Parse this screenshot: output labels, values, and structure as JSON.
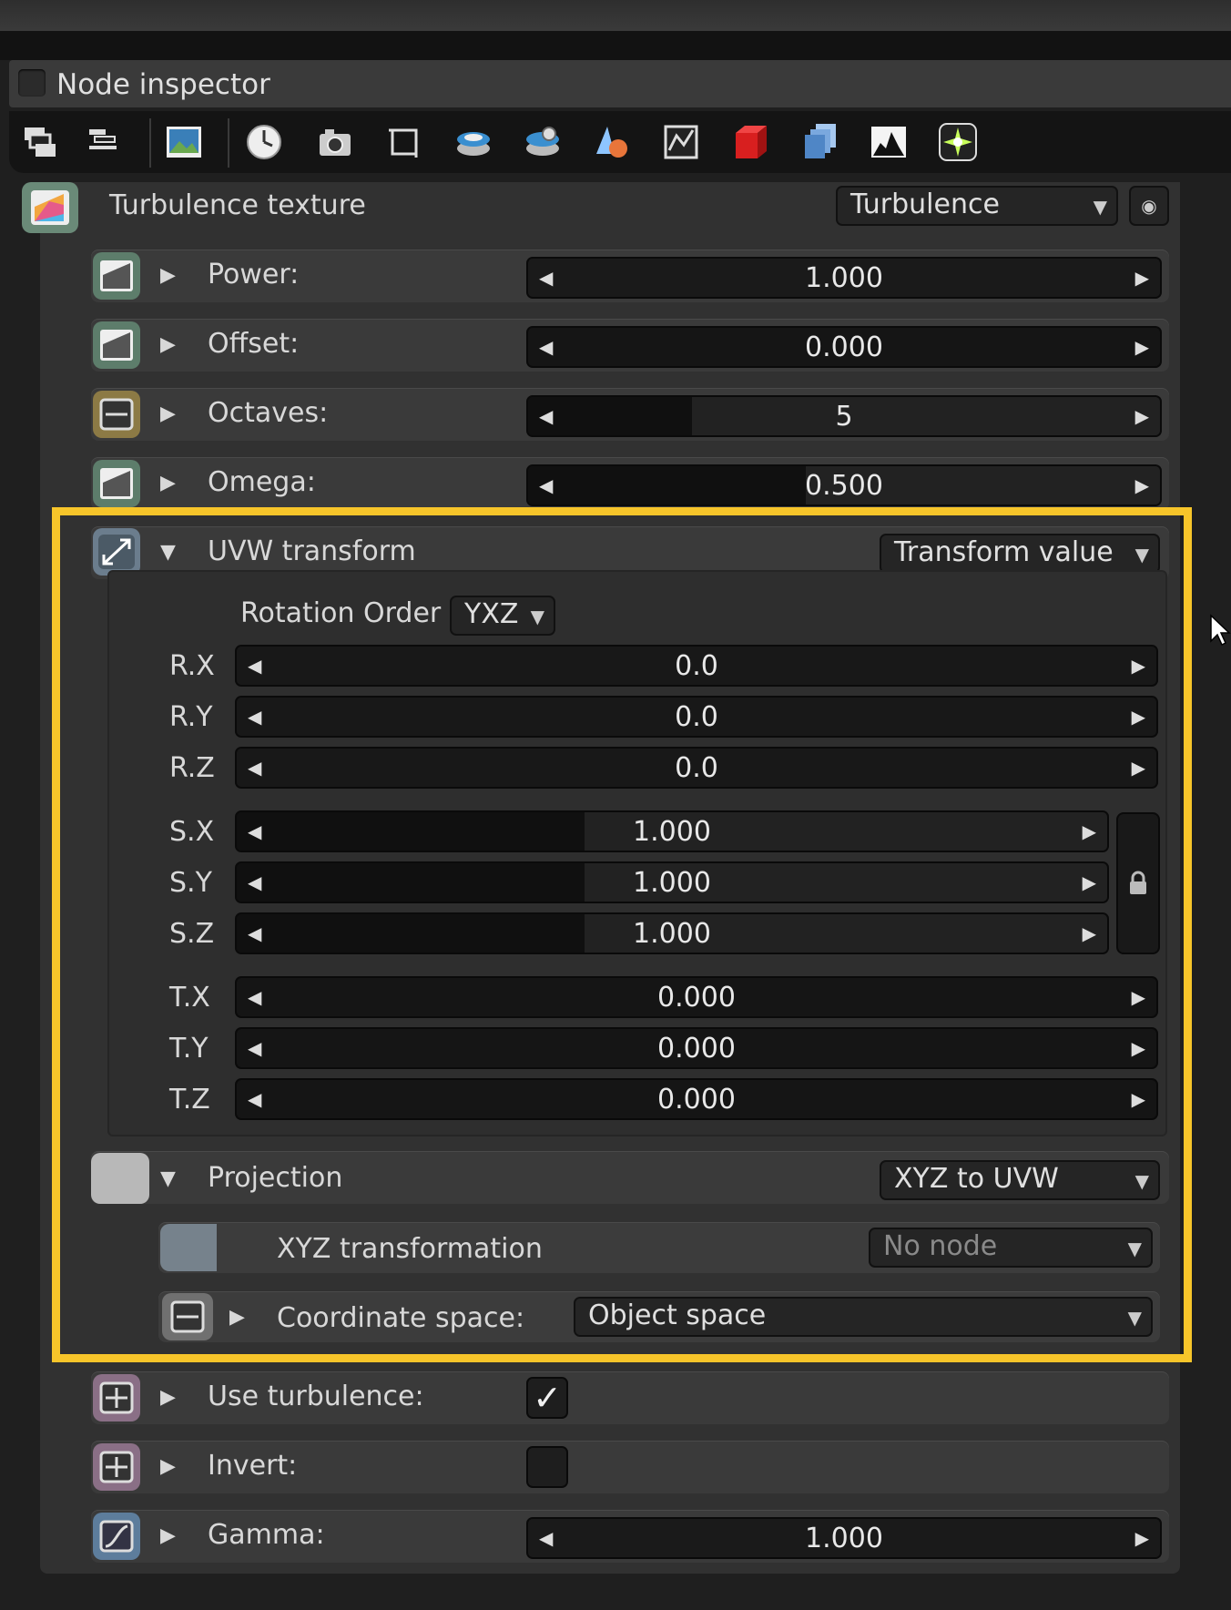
{
  "inspector": {
    "title": "Node inspector"
  },
  "toolbar": {
    "icons": [
      "layers-icon",
      "list-icon",
      "image-icon",
      "clock-icon",
      "camera-icon",
      "crop-icon",
      "disk-icon",
      "disk-settings-icon",
      "shader-icon",
      "graph-icon",
      "red-cube-icon",
      "blue-cube-icon",
      "histogram-icon",
      "sparkle-icon"
    ]
  },
  "node": {
    "name": "Turbulence texture",
    "type": "Turbulence"
  },
  "params": {
    "power": {
      "label": "Power:",
      "value": "1.000"
    },
    "offset": {
      "label": "Offset:",
      "value": "0.000"
    },
    "octaves": {
      "label": "Octaves:",
      "value": "5"
    },
    "omega": {
      "label": "Omega:",
      "value": "0.500"
    }
  },
  "uvw": {
    "label": "UVW transform",
    "mode": "Transform value",
    "rotation_order_label": "Rotation Order",
    "rotation_order": "YXZ",
    "rx": {
      "label": "R.X",
      "value": "0.0"
    },
    "ry": {
      "label": "R.Y",
      "value": "0.0"
    },
    "rz": {
      "label": "R.Z",
      "value": "0.0"
    },
    "sx": {
      "label": "S.X",
      "value": "1.000"
    },
    "sy": {
      "label": "S.Y",
      "value": "1.000"
    },
    "sz": {
      "label": "S.Z",
      "value": "1.000"
    },
    "tx": {
      "label": "T.X",
      "value": "0.000"
    },
    "ty": {
      "label": "T.Y",
      "value": "0.000"
    },
    "tz": {
      "label": "T.Z",
      "value": "0.000"
    }
  },
  "projection": {
    "label": "Projection",
    "mode": "XYZ to UVW",
    "xyz_label": "XYZ transformation",
    "xyz_value": "No node",
    "coord_label": "Coordinate space:",
    "coord_value": "Object space"
  },
  "use_turbulence": {
    "label": "Use turbulence:",
    "checked": true,
    "check_glyph": "✓"
  },
  "invert": {
    "label": "Invert:",
    "checked": false
  },
  "gamma": {
    "label": "Gamma:",
    "value": "1.000"
  },
  "colors": {
    "highlight": "#f7c52a",
    "panel": "#313131"
  }
}
